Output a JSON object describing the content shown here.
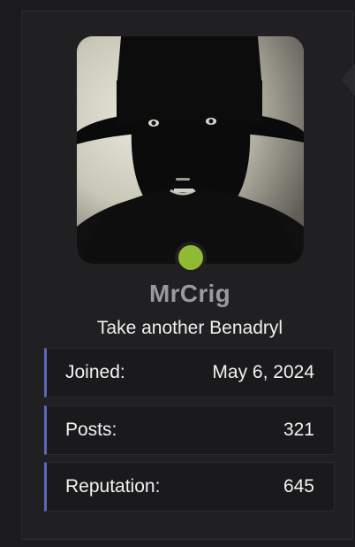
{
  "profile": {
    "username": "MrCrig",
    "title": "Take another Benadryl",
    "online_status_color": "#8fba34",
    "avatar_icon": "profile-photo"
  },
  "stats": [
    {
      "label": "Joined:",
      "value": "May 6, 2024"
    },
    {
      "label": "Posts:",
      "value": "321"
    },
    {
      "label": "Reputation:",
      "value": "645"
    }
  ],
  "colors": {
    "accent": "#5a68b5",
    "background": "#1b1b1d",
    "card": "#202022"
  }
}
